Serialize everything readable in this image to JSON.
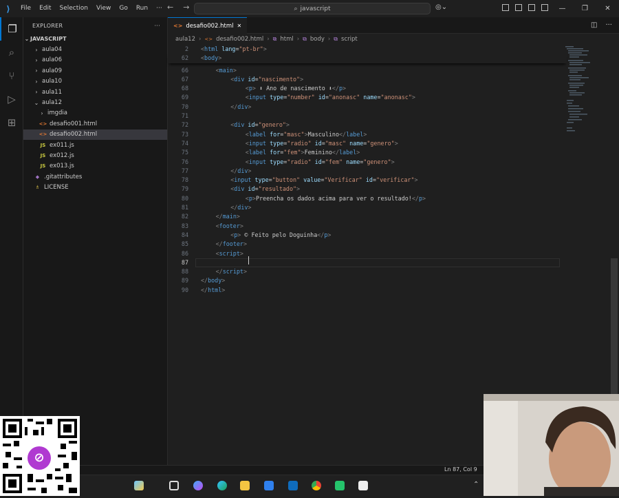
{
  "menu": [
    "File",
    "Edit",
    "Selection",
    "View",
    "Go",
    "Run",
    "···"
  ],
  "search": {
    "text": "javascript"
  },
  "explorer": {
    "title": "EXPLORER",
    "more": "···",
    "root": "JAVASCRIPT",
    "items": [
      {
        "label": "aula04",
        "kind": "folder",
        "depth": 1,
        "chevron": "›"
      },
      {
        "label": "aula06",
        "kind": "folder",
        "depth": 1,
        "chevron": "›"
      },
      {
        "label": "aula09",
        "kind": "folder",
        "depth": 1,
        "chevron": "›"
      },
      {
        "label": "aula10",
        "kind": "folder",
        "depth": 1,
        "chevron": "›"
      },
      {
        "label": "aula11",
        "kind": "folder",
        "depth": 1,
        "chevron": "›"
      },
      {
        "label": "aula12",
        "kind": "folder",
        "depth": 1,
        "chevron": "⌄"
      },
      {
        "label": "imgdia",
        "kind": "folder",
        "depth": 2,
        "chevron": "›"
      },
      {
        "label": "desafio001.html",
        "kind": "html",
        "depth": 2,
        "icon": "<>"
      },
      {
        "label": "desafio002.html",
        "kind": "html",
        "depth": 2,
        "icon": "<>",
        "selected": true
      },
      {
        "label": "ex011.js",
        "kind": "js",
        "depth": 2,
        "icon": "JS"
      },
      {
        "label": "ex012.js",
        "kind": "js",
        "depth": 2,
        "icon": "JS"
      },
      {
        "label": "ex013.js",
        "kind": "js",
        "depth": 2,
        "icon": "JS"
      },
      {
        "label": ".gitattributes",
        "kind": "git",
        "depth": 1,
        "icon": "◆"
      },
      {
        "label": "LICENSE",
        "kind": "lic",
        "depth": 1,
        "icon": "♗"
      }
    ]
  },
  "tab": {
    "label": "desafio002.html",
    "close": "✕"
  },
  "breadcrumb": {
    "folder": "aula12",
    "file": "desafio002.html",
    "html": "html",
    "body": "body",
    "script": "script"
  },
  "code": {
    "sticky": [
      {
        "n": "2",
        "html": "<span class='b'>&lt;</span><span class='t'>html</span> <span class='a'>lang</span><span class='p'>=</span><span class='s'>\"pt-br\"</span><span class='b'>&gt;</span>"
      },
      {
        "n": "62",
        "html": "<span class='b'>&lt;</span><span class='t'>body</span><span class='b'>&gt;</span>"
      }
    ],
    "lines": [
      {
        "n": "66",
        "indent": 2,
        "html": "<span class='b'>&lt;</span><span class='t'>main</span><span class='b'>&gt;</span>"
      },
      {
        "n": "67",
        "indent": 4,
        "html": "<span class='b'>&lt;</span><span class='t'>div</span> <span class='a'>id</span><span class='p'>=</span><span class='s'>\"nascimento\"</span><span class='b'>&gt;</span>"
      },
      {
        "n": "68",
        "indent": 6,
        "html": "<span class='b'>&lt;</span><span class='t'>p</span><span class='b'>&gt;</span><span class='p'> ⬇ Ano de nascimento ⬇</span><span class='b'>&lt;/</span><span class='t'>p</span><span class='b'>&gt;</span>"
      },
      {
        "n": "69",
        "indent": 6,
        "html": "<span class='b'>&lt;</span><span class='t'>input</span> <span class='a'>type</span><span class='p'>=</span><span class='s'>\"number\"</span> <span class='a'>id</span><span class='p'>=</span><span class='s'>\"anonasc\"</span> <span class='a'>name</span><span class='p'>=</span><span class='s'>\"anonasc\"</span><span class='b'>&gt;</span>"
      },
      {
        "n": "70",
        "indent": 4,
        "html": "<span class='b'>&lt;/</span><span class='t'>div</span><span class='b'>&gt;</span>"
      },
      {
        "n": "71",
        "indent": 0,
        "html": ""
      },
      {
        "n": "72",
        "indent": 4,
        "html": "<span class='b'>&lt;</span><span class='t'>div</span> <span class='a'>id</span><span class='p'>=</span><span class='s'>\"genero\"</span><span class='b'>&gt;</span>"
      },
      {
        "n": "73",
        "indent": 6,
        "html": "<span class='b'>&lt;</span><span class='t'>label</span> <span class='a'>for</span><span class='p'>=</span><span class='s'>\"masc\"</span><span class='b'>&gt;</span><span class='p'>Masculino</span><span class='b'>&lt;/</span><span class='t'>label</span><span class='b'>&gt;</span>"
      },
      {
        "n": "74",
        "indent": 6,
        "html": "<span class='b'>&lt;</span><span class='t'>input</span> <span class='a'>type</span><span class='p'>=</span><span class='s'>\"radio\"</span> <span class='a'>id</span><span class='p'>=</span><span class='s'>\"masc\"</span> <span class='a'>name</span><span class='p'>=</span><span class='s'>\"genero\"</span><span class='b'>&gt;</span>"
      },
      {
        "n": "75",
        "indent": 6,
        "html": "<span class='b'>&lt;</span><span class='t'>label</span> <span class='a'>for</span><span class='p'>=</span><span class='s'>\"fem\"</span><span class='b'>&gt;</span><span class='p'>Feminino</span><span class='b'>&lt;/</span><span class='t'>label</span><span class='b'>&gt;</span>"
      },
      {
        "n": "76",
        "indent": 6,
        "html": "<span class='b'>&lt;</span><span class='t'>input</span> <span class='a'>type</span><span class='p'>=</span><span class='s'>\"radio\"</span> <span class='a'>id</span><span class='p'>=</span><span class='s'>\"fem\"</span> <span class='a'>name</span><span class='p'>=</span><span class='s'>\"genero\"</span><span class='b'>&gt;</span>"
      },
      {
        "n": "77",
        "indent": 4,
        "html": "<span class='b'>&lt;/</span><span class='t'>div</span><span class='b'>&gt;</span>"
      },
      {
        "n": "78",
        "indent": 4,
        "html": "<span class='b'>&lt;</span><span class='t'>input</span> <span class='a'>type</span><span class='p'>=</span><span class='s'>\"button\"</span> <span class='a'>value</span><span class='p'>=</span><span class='s'>\"Verificar\"</span> <span class='a'>id</span><span class='p'>=</span><span class='s'>\"verificar\"</span><span class='b'>&gt;</span>"
      },
      {
        "n": "79",
        "indent": 4,
        "html": "<span class='b'>&lt;</span><span class='t'>div</span> <span class='a'>id</span><span class='p'>=</span><span class='s'>\"resultado\"</span><span class='b'>&gt;</span>"
      },
      {
        "n": "80",
        "indent": 6,
        "html": "<span class='b'>&lt;</span><span class='t'>p</span><span class='b'>&gt;</span><span class='p'>Preencha os dados acima para ver o resultado!</span><span class='b'>&lt;/</span><span class='t'>p</span><span class='b'>&gt;</span>"
      },
      {
        "n": "81",
        "indent": 4,
        "html": "<span class='b'>&lt;/</span><span class='t'>div</span><span class='b'>&gt;</span>"
      },
      {
        "n": "82",
        "indent": 2,
        "html": "<span class='b'>&lt;/</span><span class='t'>main</span><span class='b'>&gt;</span>"
      },
      {
        "n": "83",
        "indent": 2,
        "html": "<span class='b'>&lt;</span><span class='t'>footer</span><span class='b'>&gt;</span>"
      },
      {
        "n": "84",
        "indent": 4,
        "html": "<span class='b'>&lt;</span><span class='t'>p</span><span class='b'>&gt;</span><span class='p'> © Feito pelo Doguinha</span><span class='b'>&lt;/</span><span class='t'>p</span><span class='b'>&gt;</span>"
      },
      {
        "n": "85",
        "indent": 2,
        "html": "<span class='b'>&lt;/</span><span class='t'>footer</span><span class='b'>&gt;</span>"
      },
      {
        "n": "86",
        "indent": 2,
        "html": "<span class='b'>&lt;</span><span class='t'>script</span><span class='b'>&gt;</span>"
      },
      {
        "n": "87",
        "indent": 0,
        "html": "",
        "current": true
      },
      {
        "n": "88",
        "indent": 2,
        "html": "<span class='b'>&lt;/</span><span class='t'>script</span><span class='b'>&gt;</span>"
      },
      {
        "n": "89",
        "indent": 0,
        "html": "<span class='b'>&lt;/</span><span class='t'>body</span><span class='b'>&gt;</span>"
      },
      {
        "n": "90",
        "indent": 0,
        "html": "<span class='b'>&lt;/</span><span class='t'>html</span><span class='b'>&gt;</span>"
      }
    ]
  },
  "status": {
    "position": "Ln 87, Col 9"
  },
  "colors": {
    "accent": "#0078d4",
    "tag": "#569cd6",
    "attr": "#9cdcfe",
    "string": "#ce9178"
  }
}
